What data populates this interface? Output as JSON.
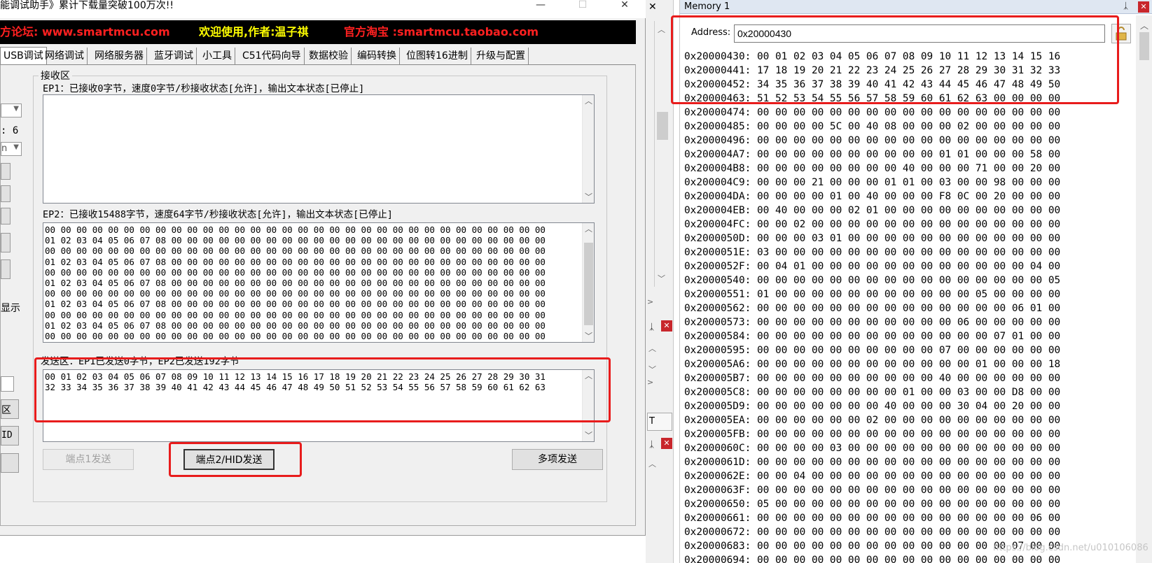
{
  "app": {
    "title": "能调试助手》累计下载量突破100万次!!",
    "min_glyph": "—",
    "max_glyph": "☐",
    "close_glyph": "✕",
    "banner": [
      {
        "text": "方论坛: www.smartmcu.com",
        "color": "#ff2020"
      },
      {
        "text": "欢迎使用,作者:温子祺",
        "color": "#ffff00"
      },
      {
        "text": "官方淘宝 :smartmcu.taobao.com",
        "color": "#ff2020"
      }
    ],
    "tabs": [
      "USB调试",
      "网络调试",
      "网络服务器",
      "蓝牙调试",
      "小工具",
      "C51代码向导",
      "数据校验",
      "编码转换",
      "位图转16进制",
      "升级与配置"
    ],
    "left_stub": {
      "colon6": ": 6",
      "n_label": "n",
      "show_label": "显示",
      "area_label": "区",
      "id_label": "ID"
    }
  },
  "receive": {
    "group_title": "接收区",
    "ep1_status": "EP1：已接收0字节，速度0字节/秒接收状态[允许]，输出文本状态[已停止]",
    "ep2_status": "EP2：已接收15488字节，速度64字节/秒接收状态[允许]，输出文本状态[已停止]",
    "ep1_text": "",
    "ep2_text": "00 00 00 00 00 00 00 00 00 00 00 00 00 00 00 00 00 00 00 00 00 00 00 00 00 00 00 00 00 00 00 00\n01 02 03 04 05 06 07 08 00 00 00 00 00 00 00 00 00 00 00 00 00 00 00 00 00 00 00 00 00 00 00 00\n00 00 00 00 00 00 00 00 00 00 00 00 00 00 00 00 00 00 00 00 00 00 00 00 00 00 00 00 00 00 00 00\n01 02 03 04 05 06 07 08 00 00 00 00 00 00 00 00 00 00 00 00 00 00 00 00 00 00 00 00 00 00 00 00\n00 00 00 00 00 00 00 00 00 00 00 00 00 00 00 00 00 00 00 00 00 00 00 00 00 00 00 00 00 00 00 00\n01 02 03 04 05 06 07 08 00 00 00 00 00 00 00 00 00 00 00 00 00 00 00 00 00 00 00 00 00 00 00 00\n00 00 00 00 00 00 00 00 00 00 00 00 00 00 00 00 00 00 00 00 00 00 00 00 00 00 00 00 00 00 00 00\n01 02 03 04 05 06 07 08 00 00 00 00 00 00 00 00 00 00 00 00 00 00 00 00 00 00 00 00 00 00 00 00\n00 00 00 00 00 00 00 00 00 00 00 00 00 00 00 00 00 00 00 00 00 00 00 00 00 00 00 00 00 00 00 00\n01 02 03 04 05 06 07 08 00 00 00 00 00 00 00 00 00 00 00 00 00 00 00 00 00 00 00 00 00 00 00 00\n00 00 00 00 00 00 00 00 00 00 00 00 00 00 00 00 00 00 00 00 00 00 00 00 00 00 00 00 00 00 00 00"
  },
  "send": {
    "group_title": "发送区：EP1已发送0字节，EP2已发送192字节",
    "text": "00 01 02 03 04 05 06 07 08 09 10 11 12 13 14 15 16 17 18 19 20 21 22 23 24 25 26 27 28 29 30 31\n32 33 34 35 36 37 38 39 40 41 42 43 44 45 46 47 48 49 50 51 52 53 54 55 56 57 58 59 60 61 62 63",
    "btn_ep1": "端点1发送",
    "btn_ep2": "端点2/HID发送",
    "btn_multi": "多项发送"
  },
  "memory": {
    "title": "Memory 1",
    "address_label": "Address:",
    "address_value": "0x20000430",
    "lines": [
      "0x20000430: 00 01 02 03 04 05 06 07 08 09 10 11 12 13 14 15 16",
      "0x20000441: 17 18 19 20 21 22 23 24 25 26 27 28 29 30 31 32 33",
      "0x20000452: 34 35 36 37 38 39 40 41 42 43 44 45 46 47 48 49 50",
      "0x20000463: 51 52 53 54 55 56 57 58 59 60 61 62 63 00 00 00 00",
      "0x20000474: 00 00 00 00 00 00 00 00 00 00 00 00 00 00 00 00 00",
      "0x20000485: 00 00 00 00 5C 00 40 08 00 00 00 02 00 00 00 00 00",
      "0x20000496: 00 00 00 00 00 00 00 00 00 00 00 00 00 00 00 00 00",
      "0x200004A7: 00 00 00 00 00 00 00 00 00 00 01 01 00 00 00 58 00",
      "0x200004B8: 00 00 00 00 00 00 00 00 40 00 00 00 71 00 00 20 00",
      "0x200004C9: 00 00 00 21 00 00 00 01 01 00 03 00 00 98 00 00 00",
      "0x200004DA: 00 00 00 00 01 00 40 00 00 00 F8 0C 00 20 00 00 00",
      "0x200004EB: 00 40 00 00 00 02 01 00 00 00 00 00 00 00 00 00 00",
      "0x200004FC: 00 00 02 00 00 00 00 00 00 00 00 00 00 00 00 00 00",
      "0x2000050D: 00 00 00 03 01 00 00 00 00 00 00 00 00 00 00 00 00",
      "0x2000051E: 03 00 00 00 00 00 00 00 00 00 00 00 00 00 00 00 00",
      "0x2000052F: 00 04 01 00 00 00 00 00 00 00 00 00 00 00 00 04 00",
      "0x20000540: 00 00 00 00 00 00 00 00 00 00 00 00 00 00 00 00 05",
      "0x20000551: 01 00 00 00 00 00 00 00 00 00 00 00 05 00 00 00 00",
      "0x20000562: 00 00 00 00 00 00 00 00 00 00 00 00 00 00 06 01 00",
      "0x20000573: 00 00 00 00 00 00 00 00 00 00 00 06 00 00 00 00 00",
      "0x20000584: 00 00 00 00 00 00 00 00 00 00 00 00 00 07 01 00 00",
      "0x20000595: 00 00 00 00 00 00 00 00 00 00 07 00 00 00 00 00 00",
      "0x200005A6: 00 00 00 00 00 00 00 00 00 00 00 00 01 00 00 00 18",
      "0x200005B7: 00 00 00 00 00 00 00 00 00 00 40 00 00 00 00 00 00",
      "0x200005C8: 00 00 00 00 00 00 00 00 01 00 00 03 00 00 D8 00 00",
      "0x200005D9: 00 00 00 00 00 00 00 40 00 00 00 30 04 00 20 00 00",
      "0x200005EA: 00 00 00 00 00 00 02 00 00 00 00 00 00 00 00 00 00",
      "0x200005FB: 00 00 00 00 00 00 00 00 00 00 00 00 00 00 00 00 00",
      "0x2000060C: 00 00 00 00 03 00 00 00 00 00 00 00 00 00 00 00 00",
      "0x2000061D: 00 00 00 00 00 00 00 00 00 00 00 00 00 00 00 00 00",
      "0x2000062E: 00 00 04 00 00 00 00 00 00 00 00 00 00 00 00 00 00",
      "0x2000063F: 00 00 00 00 00 00 00 00 00 00 00 00 00 00 00 00 00",
      "0x20000650: 05 00 00 00 00 00 00 00 00 00 00 00 00 00 00 00 00",
      "0x20000661: 00 00 00 00 00 00 00 00 00 00 00 00 00 00 00 06 00",
      "0x20000672: 00 00 00 00 00 00 00 00 00 00 00 00 00 00 00 00 00",
      "0x20000683: 00 00 00 00 00 00 00 00 00 00 00 00 00 00 07 00 00",
      "0x20000694: 00 00 00 00 00 00 00 00 00 00 00 00 00 00 00 00 00"
    ]
  },
  "midstrip": {
    "close_glyph": "✕",
    "pin_glyph": "ᛣ",
    "t_label": "T"
  },
  "watermark": "https://blog.csdn.net/u010106086",
  "colors": {
    "highlight": "#e81c1c",
    "banner_bg": "#000000",
    "memory_title_bg": "#dfe7f2"
  }
}
